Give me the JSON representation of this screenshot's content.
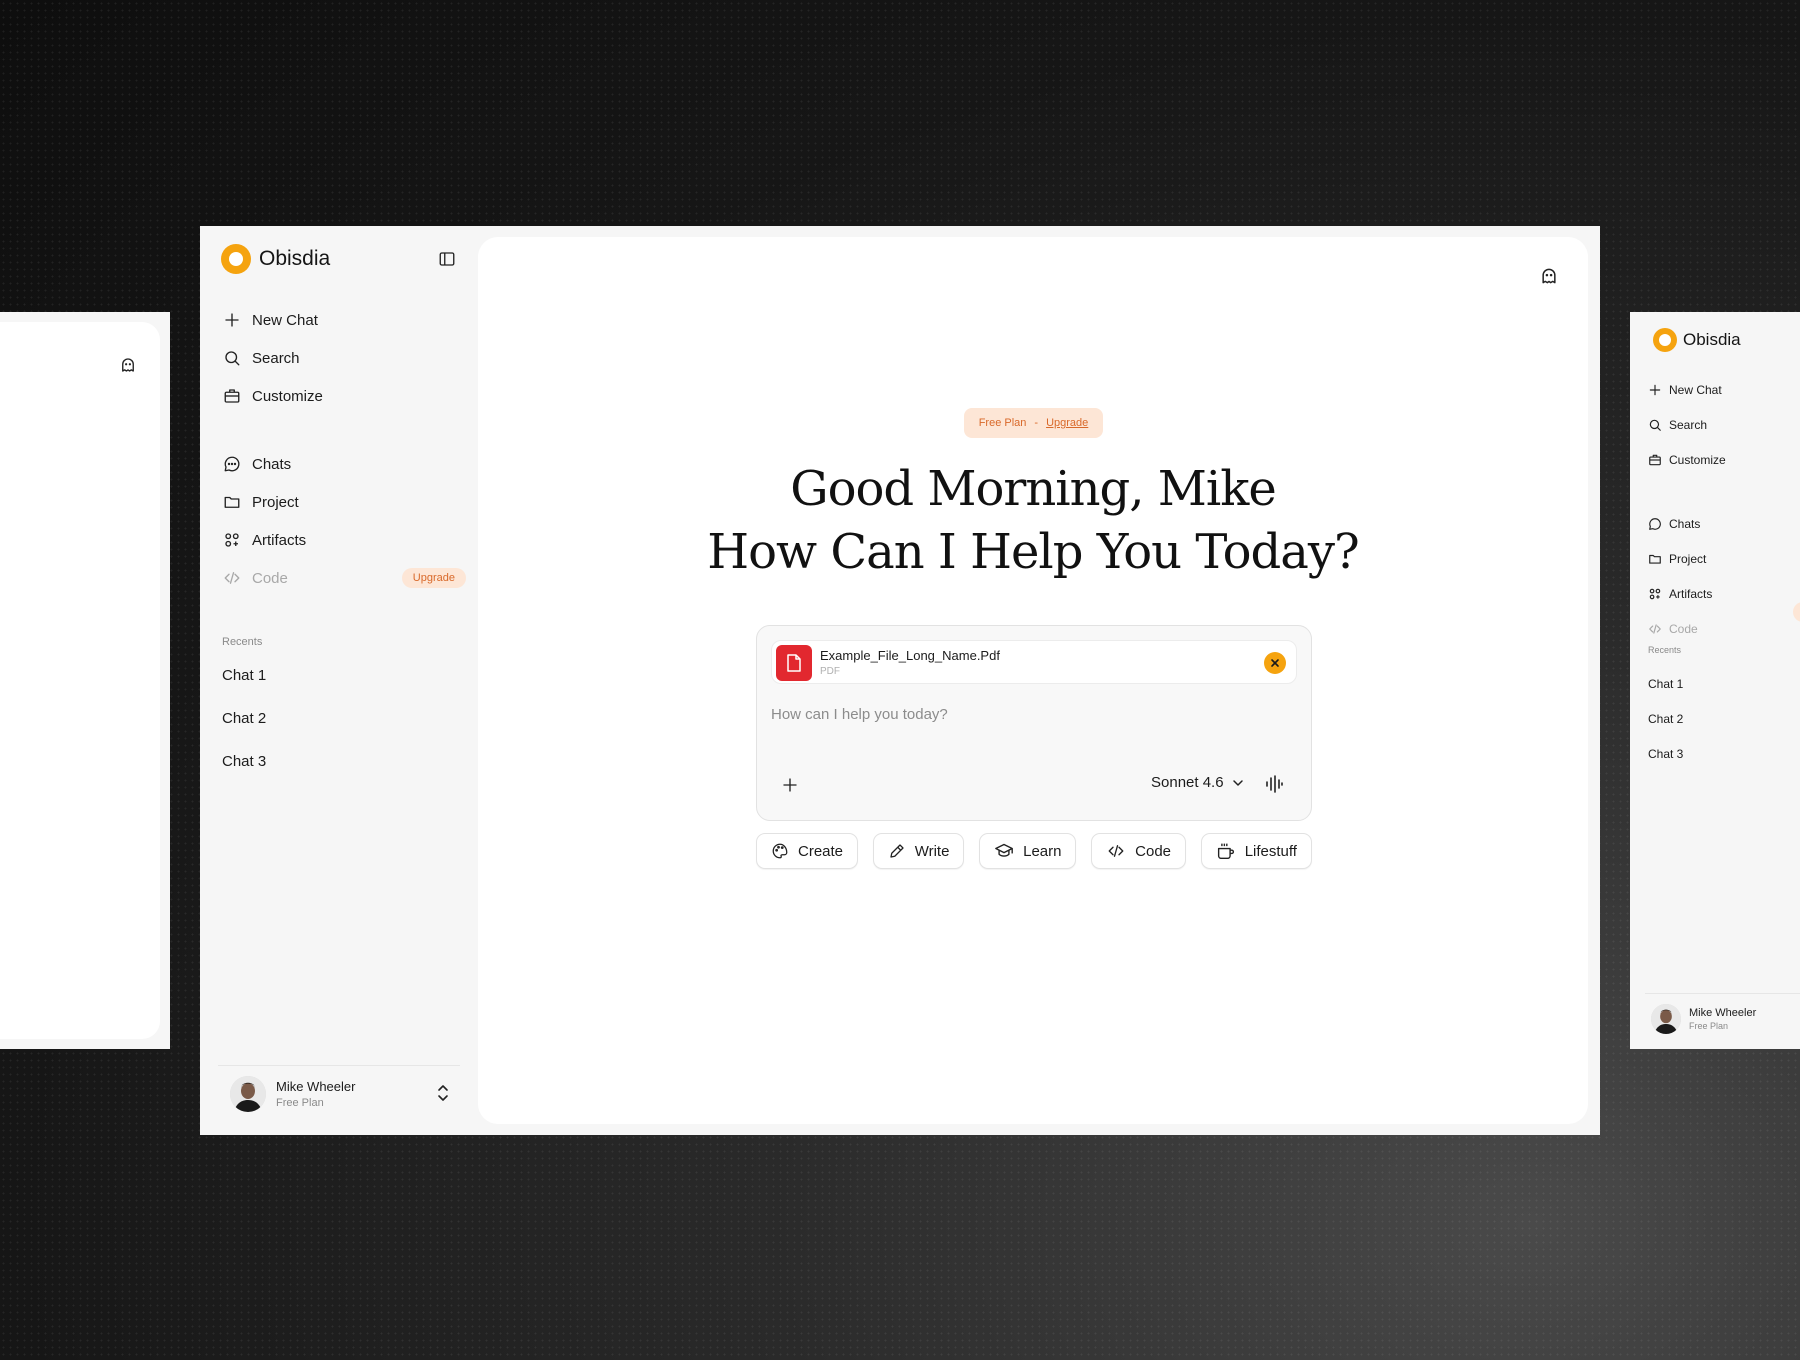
{
  "app": {
    "name": "Obisdia"
  },
  "sidebar": {
    "primary_items": [
      {
        "label": "New Chat",
        "icon": "plus-icon"
      },
      {
        "label": "Search",
        "icon": "search-icon"
      },
      {
        "label": "Customize",
        "icon": "briefcase-icon"
      }
    ],
    "secondary_items": [
      {
        "label": "Chats",
        "icon": "chat-bubble-icon"
      },
      {
        "label": "Project",
        "icon": "folder-icon"
      },
      {
        "label": "Artifacts",
        "icon": "artifacts-icon"
      },
      {
        "label": "Code",
        "icon": "code-icon",
        "badge": "Upgrade"
      }
    ],
    "recents_label": "Recents",
    "recents": [
      "Chat 1",
      "Chat 2",
      "Chat 3"
    ]
  },
  "user": {
    "name": "Mike Wheeler",
    "plan": "Free Plan"
  },
  "main": {
    "plan_pill": {
      "plan": "Free Plan",
      "separator": "-",
      "upgrade": "Upgrade"
    },
    "greeting_line1": "Good Morning, Mike",
    "greeting_line2": "How Can I Help You Today?",
    "composer": {
      "attachment": {
        "name": "Example_File_Long_Name.Pdf",
        "type": "PDF"
      },
      "placeholder": "How can I help you today?",
      "value": "",
      "model": "Sonnet 4.6"
    },
    "chips": [
      {
        "label": "Create",
        "icon": "palette-icon"
      },
      {
        "label": "Write",
        "icon": "pencil-icon"
      },
      {
        "label": "Learn",
        "icon": "graduation-cap-icon"
      },
      {
        "label": "Code",
        "icon": "code-icon"
      },
      {
        "label": "Lifestuff",
        "icon": "coffee-cup-icon"
      }
    ]
  },
  "colors": {
    "accent": "#f5a30f",
    "badge_bg": "#fde6d6",
    "badge_text": "#d9692a",
    "pdf_red": "#e2282f"
  }
}
